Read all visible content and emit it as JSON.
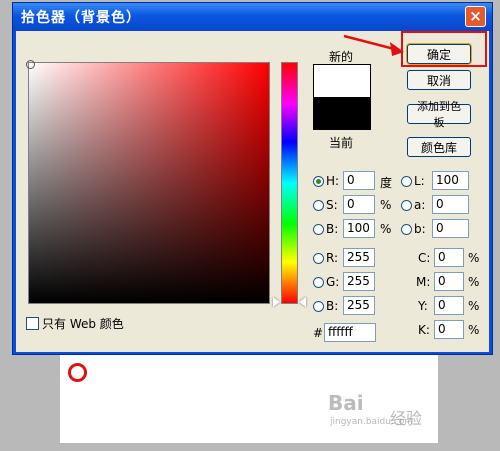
{
  "window": {
    "title": "拾色器（背景色）",
    "close_glyph": "×"
  },
  "picker": {
    "web_only_label": "只有 Web 颜色"
  },
  "swatch": {
    "new_label": "新的",
    "current_label": "当前",
    "new_color": "#ffffff",
    "current_color": "#000000"
  },
  "buttons": {
    "ok": "确定",
    "cancel": "取消",
    "add_to_swatches": "添加到色板",
    "color_library": "颜色库"
  },
  "hsb": [
    {
      "label": "H:",
      "value": "0",
      "unit": "度",
      "selected": true
    },
    {
      "label": "S:",
      "value": "0",
      "unit": "%",
      "selected": false
    },
    {
      "label": "B:",
      "value": "100",
      "unit": "%",
      "selected": false
    }
  ],
  "rgb": [
    {
      "label": "R:",
      "value": "255"
    },
    {
      "label": "G:",
      "value": "255"
    },
    {
      "label": "B:",
      "value": "255"
    }
  ],
  "lab": [
    {
      "label": "L:",
      "value": "100"
    },
    {
      "label": "a:",
      "value": "0"
    },
    {
      "label": "b:",
      "value": "0"
    }
  ],
  "cmyk": [
    {
      "label": "C:",
      "value": "0",
      "unit": "%"
    },
    {
      "label": "M:",
      "value": "0",
      "unit": "%"
    },
    {
      "label": "Y:",
      "value": "0",
      "unit": "%"
    },
    {
      "label": "K:",
      "value": "0",
      "unit": "%"
    }
  ],
  "hex": {
    "label": "#",
    "value": "ffffff"
  },
  "watermark": {
    "brand": "Bai",
    "brand2": "经验",
    "url": "jingyan.baidu.com"
  },
  "colors": {
    "accent_red": "#e01010",
    "title_blue": "#0a4fd8"
  }
}
